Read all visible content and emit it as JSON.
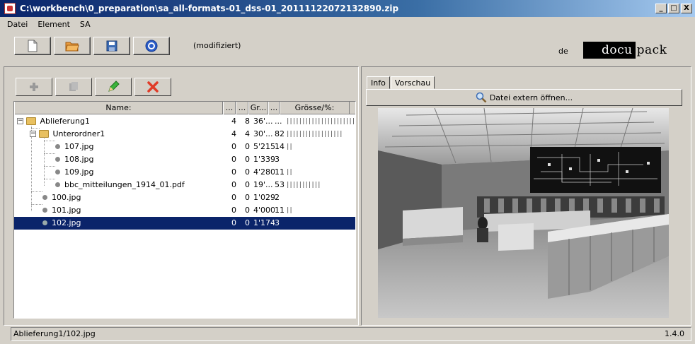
{
  "window": {
    "title": "C:\\workbench\\0_preparation\\sa_all-formats-01_dss-01_20111122072132890.zip",
    "controls": [
      "_",
      "□",
      "X"
    ]
  },
  "menu": [
    "Datei",
    "Element",
    "SA"
  ],
  "toolbar": {
    "status": "(modifiziert)",
    "language": "de",
    "logo_dark": "docu",
    "logo_light": "pack",
    "buttons": [
      "new-document-icon",
      "open-folder-icon",
      "save-disk-icon",
      "target-icon"
    ]
  },
  "left_toolbar": {
    "buttons": [
      "plus-icon",
      "copy-icon",
      "pencil-icon",
      "delete-x-icon"
    ]
  },
  "tree": {
    "columns": [
      "Name:",
      "...",
      "...",
      "Gr...",
      "...",
      "Grösse/%:"
    ],
    "rows": [
      {
        "name": "Ablieferung1",
        "c1": "4",
        "c2": "8",
        "c3": "36'...",
        "c4": "...",
        "bars": "||||||||||||||||||||||",
        "type": "folder",
        "level": 0,
        "expander": "−"
      },
      {
        "name": "Unterordner1",
        "c1": "4",
        "c2": "4",
        "c3": "30'...",
        "c4": "82",
        "bars": "||||||||||||||||||",
        "type": "folder",
        "level": 1,
        "expander": "−"
      },
      {
        "name": "107.jpg",
        "c1": "0",
        "c2": "0",
        "c3": "5'215",
        "c4": "14",
        "bars": "||",
        "type": "file",
        "level": 2
      },
      {
        "name": "108.jpg",
        "c1": "0",
        "c2": "0",
        "c3": "1'339",
        "c4": "3",
        "bars": "",
        "type": "file",
        "level": 2
      },
      {
        "name": "109.jpg",
        "c1": "0",
        "c2": "0",
        "c3": "4'280",
        "c4": "11",
        "bars": "||",
        "type": "file",
        "level": 2
      },
      {
        "name": "bbc_mitteilungen_1914_01.pdf",
        "c1": "0",
        "c2": "0",
        "c3": "19'...",
        "c4": "53",
        "bars": "|||||||||||",
        "type": "file",
        "level": 2
      },
      {
        "name": "100.jpg",
        "c1": "0",
        "c2": "0",
        "c3": "1'029",
        "c4": "2",
        "bars": "",
        "type": "file",
        "level": 1
      },
      {
        "name": "101.jpg",
        "c1": "0",
        "c2": "0",
        "c3": "4'000",
        "c4": "11",
        "bars": "||",
        "type": "file",
        "level": 1
      },
      {
        "name": "102.jpg",
        "c1": "0",
        "c2": "0",
        "c3": "1'174",
        "c4": "3",
        "bars": "",
        "type": "file",
        "level": 1,
        "selected": true
      }
    ]
  },
  "right_panel": {
    "tabs": [
      "Info",
      "Vorschau"
    ],
    "active_tab": "Vorschau",
    "open_button": "Datei extern öffnen..."
  },
  "statusbar": {
    "path": "Ablieferung1/102.jpg",
    "version": "1.4.0"
  }
}
